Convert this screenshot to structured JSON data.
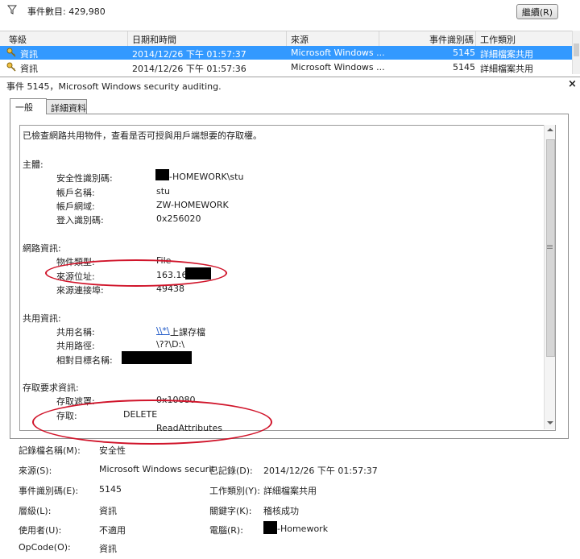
{
  "toolbar": {
    "filter_icon": "filter-icon",
    "event_count": "事件數目: 429,980",
    "continue_label": "繼續(R)"
  },
  "list": {
    "columns": [
      "等級",
      "日期和時間",
      "來源",
      "事件識別碼",
      "工作類別"
    ],
    "rows": [
      {
        "level": "資訊",
        "datetime": "2014/12/26 下午 01:57:37",
        "source": "Microsoft Windows ...",
        "id": "5145",
        "category": "詳細檔案共用",
        "selected": true
      },
      {
        "level": "資訊",
        "datetime": "2014/12/26 下午 01:57:36",
        "source": "Microsoft Windows ...",
        "id": "5145",
        "category": "詳細檔案共用",
        "selected": false
      }
    ]
  },
  "detail": {
    "title": "事件 5145，Microsoft Windows security auditing.",
    "close": "×",
    "tabs": [
      "一般",
      "詳細資料"
    ],
    "intro": "已檢查網路共用物件，查看是否可授與用戶端想要的存取權。",
    "subject": {
      "heading": "主體:",
      "sid_label": "安全性識別碼:",
      "sid_value": "-HOMEWORK\\stu",
      "account_label": "帳戶名稱:",
      "account_value": "stu",
      "domain_label": "帳戶網域:",
      "domain_value": "ZW-HOMEWORK",
      "logon_label": "登入識別碼:",
      "logon_value": "0x256020"
    },
    "network": {
      "heading": "網路資訊:",
      "objtype_label": "物件類型:",
      "objtype_value": "File",
      "srcaddr_label": "來源位址:",
      "srcaddr_value": "163.16.",
      "srcport_label": "來源連接埠:",
      "srcport_value": "49438"
    },
    "share": {
      "heading": "共用資訊:",
      "name_label": "共用名稱:",
      "name_link": "\\\\*\\",
      "name_value": "上課存檔",
      "path_label": "共用路徑:",
      "path_value": "\\??\\D:\\",
      "target_label": "相對目標名稱:"
    },
    "access": {
      "heading": "存取要求資訊:",
      "mask_label": "存取遮罩:",
      "mask_value": "0x10080",
      "access_label": "存取:",
      "access_value1": "DELETE",
      "access_value2": "ReadAttributes"
    }
  },
  "props": {
    "log_label": "記錄檔名稱(M):",
    "log_value": "安全性",
    "source_label": "來源(S):",
    "source_value": "Microsoft Windows securit",
    "logged_label": "已記錄(D):",
    "logged_value": "2014/12/26 下午 01:57:37",
    "eventid_label": "事件識別碼(E):",
    "eventid_value": "5145",
    "category_label": "工作類別(Y):",
    "category_value": "詳細檔案共用",
    "level_label": "層級(L):",
    "level_value": "資訊",
    "keywords_label": "關鍵字(K):",
    "keywords_value": "稽核成功",
    "user_label": "使用者(U):",
    "user_value": "不適用",
    "computer_label": "電腦(R):",
    "computer_value": "-Homework",
    "opcode_label": "OpCode(O):",
    "opcode_value": "資訊"
  },
  "colors": {
    "selection": "#3399ff",
    "annotation": "#d0142a",
    "link": "#1a55c6"
  }
}
